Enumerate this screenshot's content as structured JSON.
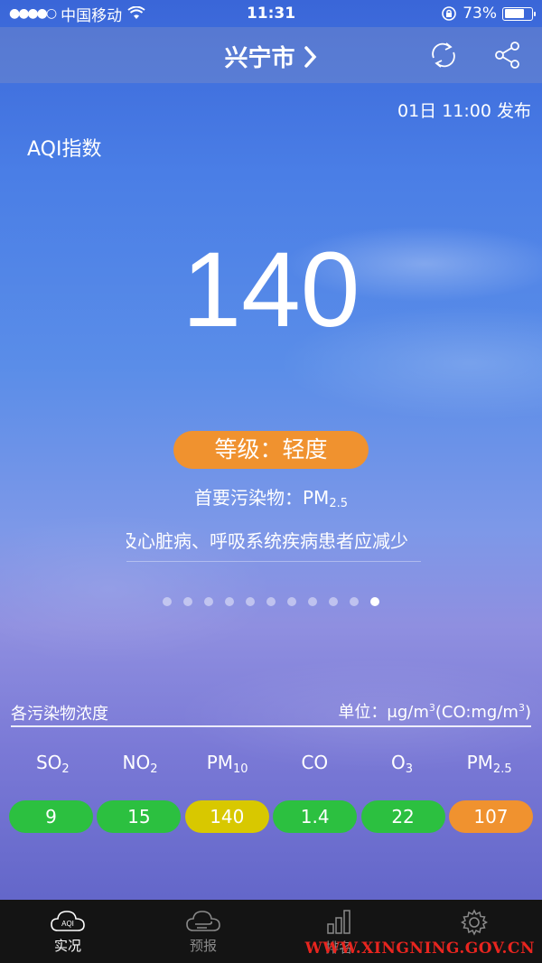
{
  "status_bar": {
    "carrier": "中国移动",
    "time": "11:31",
    "battery": "73%",
    "battery_level": 0.73
  },
  "header": {
    "city": "兴宁市",
    "refresh_icon": "refresh-icon",
    "share_icon": "share-icon"
  },
  "published": "01日 11:00 发布",
  "aqi": {
    "label": "AQI指数",
    "value": "140",
    "level": "等级：轻度",
    "level_color": "#f0922f",
    "primary_label": "首要污染物：PM",
    "primary_sub": "2.5",
    "advice": "及心脏病、呼吸系统疾病患者应减少"
  },
  "pager": {
    "count": 11,
    "active_index": 10
  },
  "concentration": {
    "title": "各污染物浓度",
    "unit_prefix": "单位：μg/m",
    "unit_sup": "3",
    "unit_mid": "(CO:mg/m",
    "unit_sup2": "3",
    "unit_end": ")",
    "pollutants": [
      {
        "name": "SO",
        "sub": "2",
        "value": "9",
        "color": "#2cc040"
      },
      {
        "name": "NO",
        "sub": "2",
        "value": "15",
        "color": "#2cc040"
      },
      {
        "name": "PM",
        "sub": "10",
        "value": "140",
        "color": "#d8c800"
      },
      {
        "name": "CO",
        "sub": "",
        "value": "1.4",
        "color": "#2cc040"
      },
      {
        "name": "O",
        "sub": "3",
        "value": "22",
        "color": "#2cc040"
      },
      {
        "name": "PM",
        "sub": "2.5",
        "value": "107",
        "color": "#f0922f"
      }
    ]
  },
  "tabs": [
    {
      "label": "实况",
      "icon": "aqi-cloud-icon",
      "active": true
    },
    {
      "label": "预报",
      "icon": "forecast-cloud-icon",
      "active": false
    },
    {
      "label": "排名",
      "icon": "bar-chart-icon",
      "active": false
    },
    {
      "label": "",
      "icon": "gear-icon",
      "active": false
    }
  ],
  "watermark": "WWW.XINGNING.GOV.CN"
}
